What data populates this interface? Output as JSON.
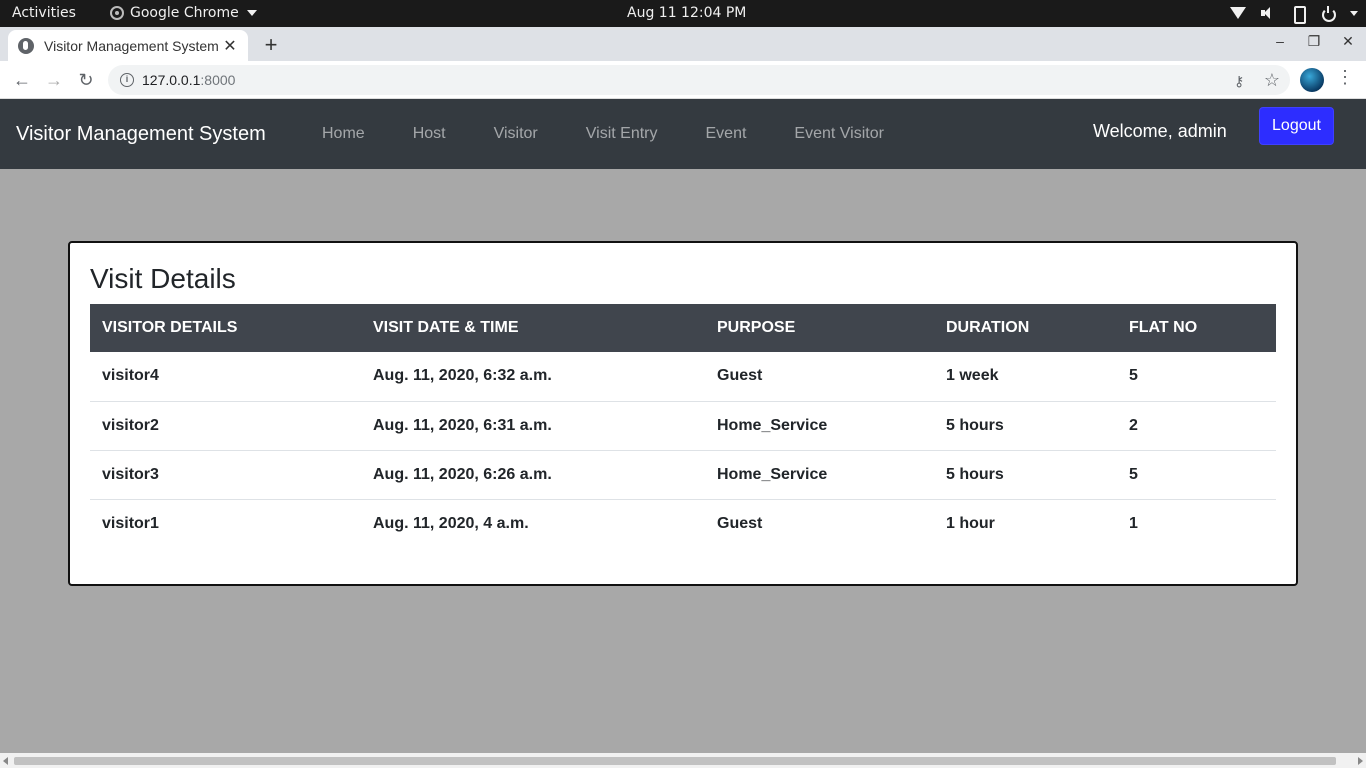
{
  "os_bar": {
    "activities": "Activities",
    "app_name": "Google Chrome",
    "clock": "Aug 11  12:04 PM"
  },
  "browser": {
    "tab_title": "Visitor Management System",
    "tab_close": "✕",
    "new_tab": "+",
    "url_host": "127.0.0.1",
    "url_port": ":8000",
    "back": "←",
    "forward": "→",
    "reload": "↻",
    "minimize": "–",
    "maximize": "❐",
    "close": "✕",
    "menu": "⋮",
    "star": "☆",
    "key": "⚷"
  },
  "navbar": {
    "brand": "Visitor Management System",
    "links": [
      "Home",
      "Host",
      "Visitor",
      "Visit Entry",
      "Event",
      "Event Visitor"
    ],
    "welcome": "Welcome, admin",
    "logout": "Logout"
  },
  "card": {
    "title": "Visit Details",
    "columns": [
      "VISITOR DETAILS",
      "VISIT DATE & TIME",
      "PURPOSE",
      "DURATION",
      "FLAT NO"
    ],
    "rows": [
      [
        "visitor4",
        "Aug. 11, 2020, 6:32 a.m.",
        "Guest",
        "1 week",
        "5"
      ],
      [
        "visitor2",
        "Aug. 11, 2020, 6:31 a.m.",
        "Home_Service",
        "5 hours",
        "2"
      ],
      [
        "visitor3",
        "Aug. 11, 2020, 6:26 a.m.",
        "Home_Service",
        "5 hours",
        "5"
      ],
      [
        "visitor1",
        "Aug. 11, 2020, 4 a.m.",
        "Guest",
        "1 hour",
        "1"
      ]
    ]
  },
  "colors": {
    "navbar_bg": "#343a40",
    "logout_bg": "#2d2dff",
    "table_header_bg": "#40454d",
    "page_bg": "#a8a8a8"
  }
}
